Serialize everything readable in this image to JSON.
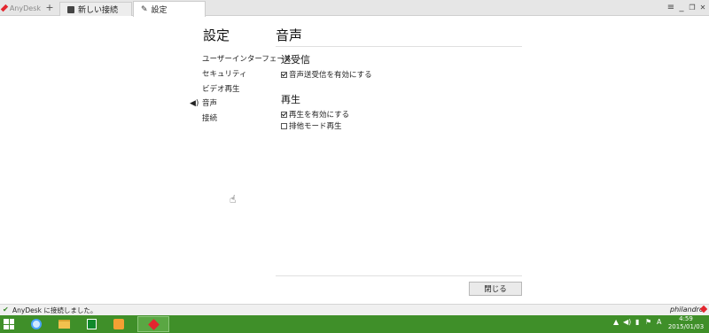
{
  "titlebar": {
    "app_name": "AnyDesk",
    "new_tab_symbol": "+",
    "tabs": [
      {
        "label": "新しい接続",
        "icon": "monitor-icon"
      },
      {
        "label": "設定",
        "icon": "wrench-icon"
      }
    ],
    "menu_symbol": "≡",
    "minimize_symbol": "_",
    "restore_symbol": "❐",
    "close_symbol": "✕"
  },
  "main": {
    "settings_title": "設定",
    "section_title": "音声",
    "nav": [
      {
        "label": "ユーザーインターフェース"
      },
      {
        "label": "セキュリティ"
      },
      {
        "label": "ビデオ再生"
      },
      {
        "label": "音声",
        "active": true
      },
      {
        "label": "接続"
      }
    ],
    "transmission": {
      "heading": "送受信",
      "option_label": "音声送受信を有効にする",
      "option_checked": true
    },
    "playback": {
      "heading": "再生",
      "options": [
        {
          "label": "再生を有効にする",
          "checked": true
        },
        {
          "label": "排他モード再生",
          "checked": false
        }
      ]
    },
    "close_button": "閉じる"
  },
  "statusbar": {
    "status_text": "AnyDesk に接続しました。",
    "brand": "philandro"
  },
  "taskbar": {
    "clock_time": "4:59",
    "clock_date": "2015/01/03",
    "ime": "A"
  },
  "colors": {
    "accent": "#e3262f",
    "taskbar": "#3f8f29"
  }
}
